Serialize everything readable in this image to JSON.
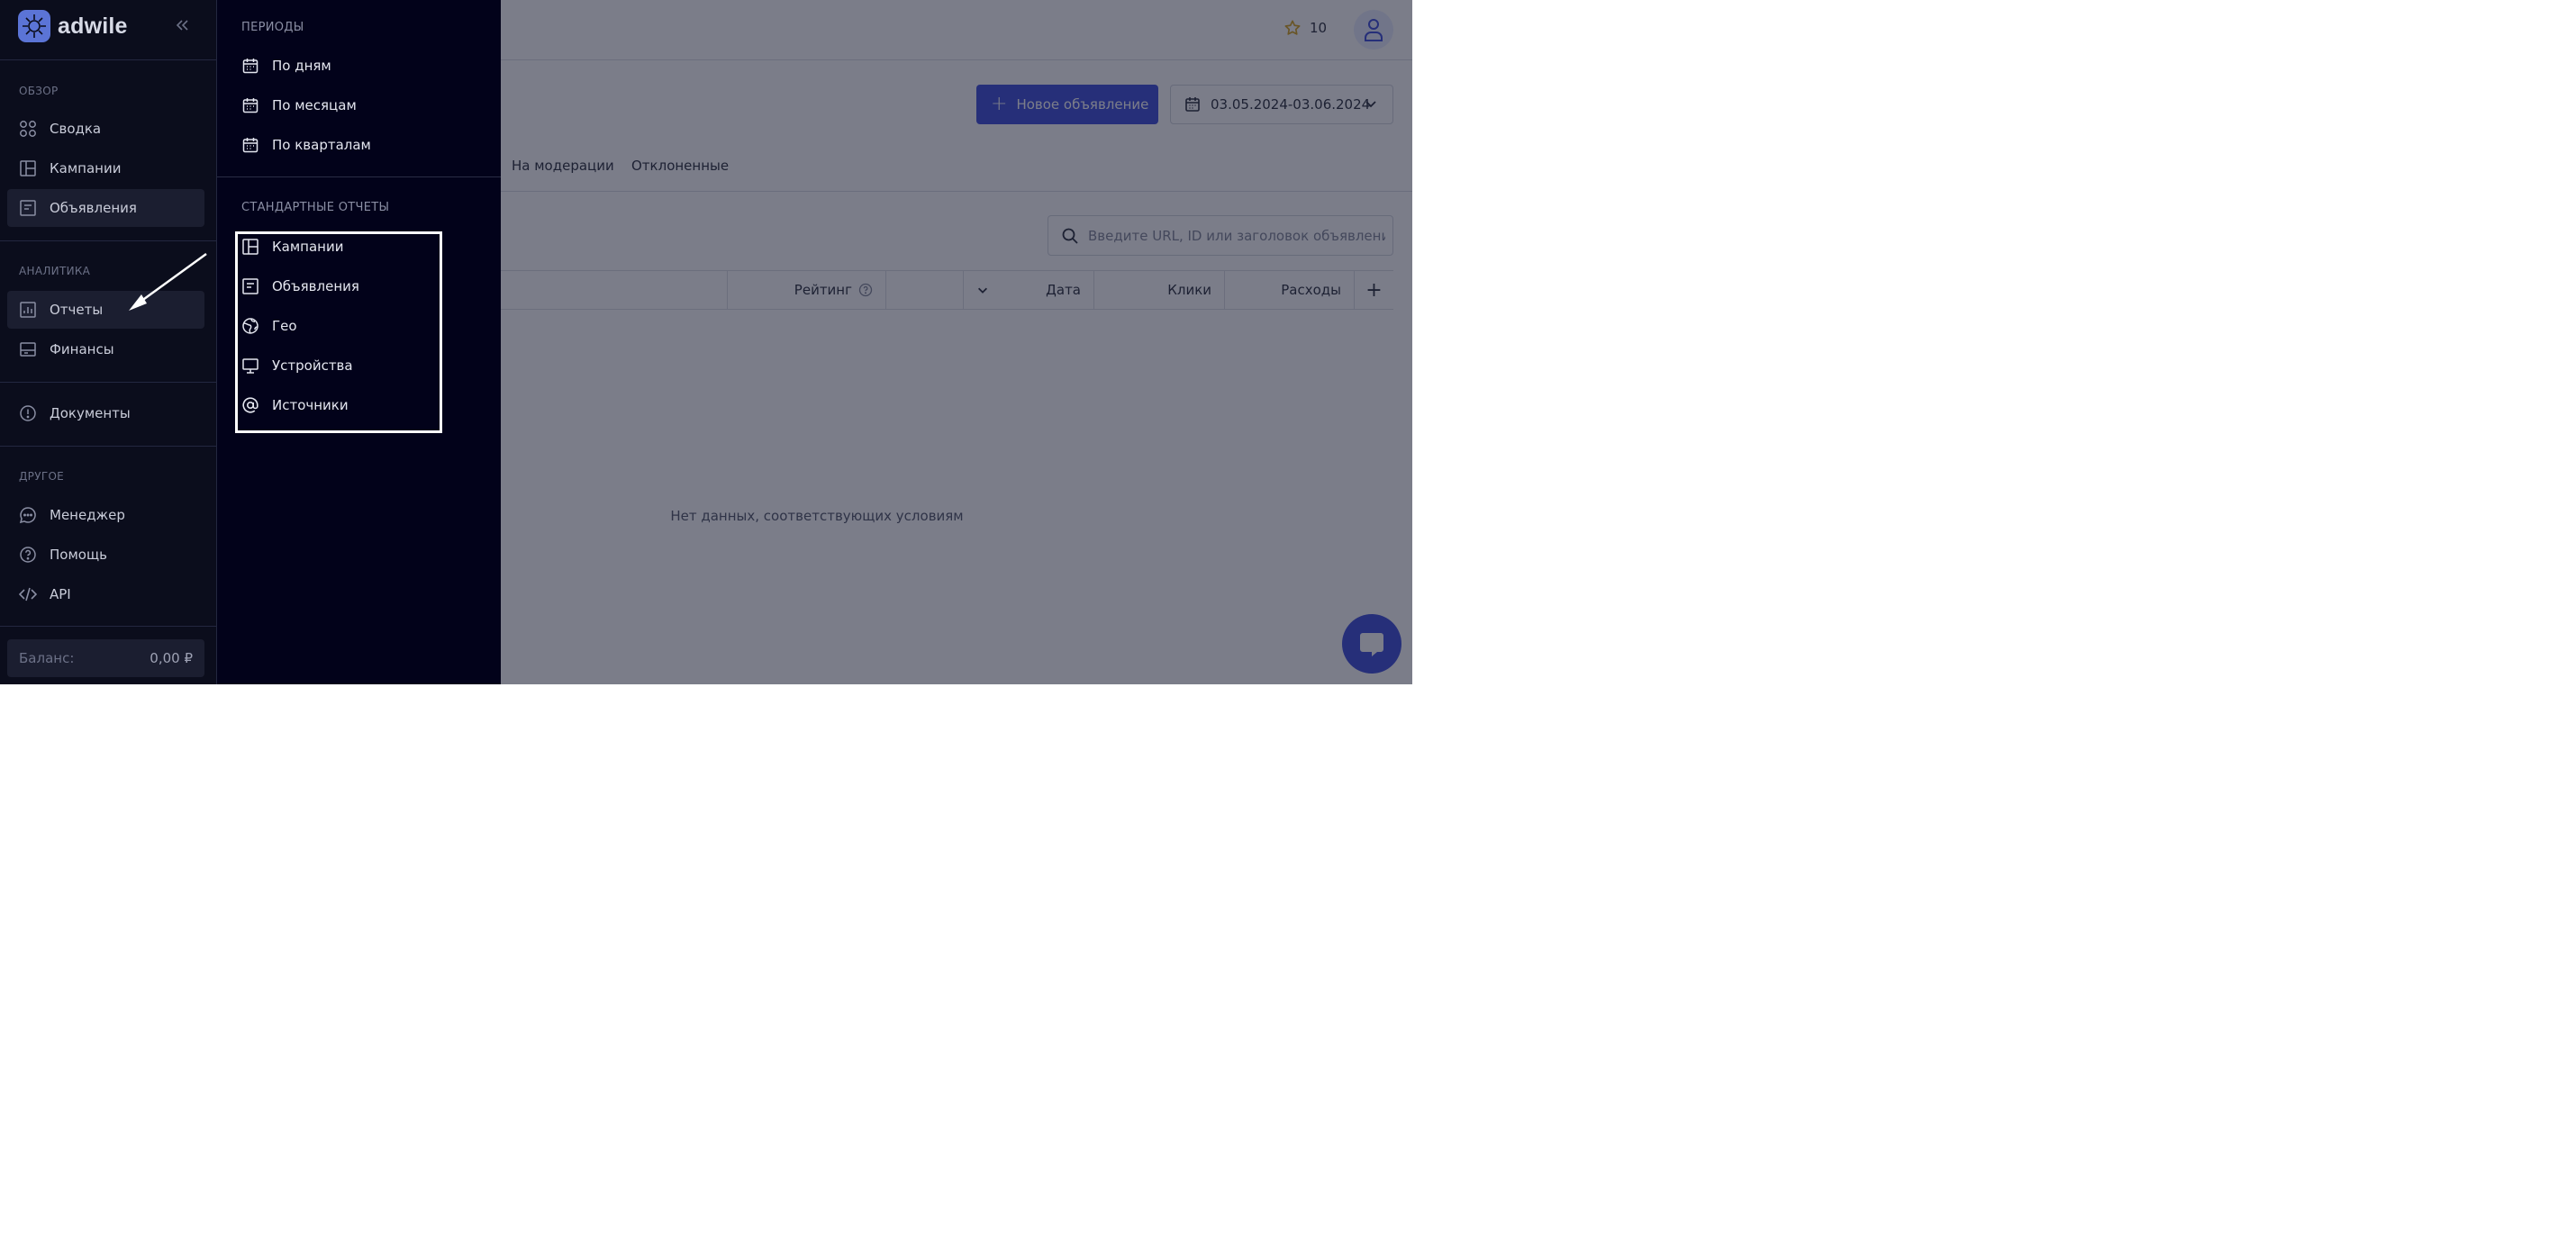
{
  "app": {
    "logo_text": "adwile"
  },
  "header": {
    "rating_count": "10"
  },
  "actions": {
    "new_ad_label": "Новое объявление",
    "date_range": "03.05.2024-03.06.2024"
  },
  "tabs": [
    "На модерации",
    "Отклоненные"
  ],
  "search": {
    "placeholder": "Введите URL, ID или заголовок объявления"
  },
  "table": {
    "columns": [
      "Рейтинг",
      "Дата",
      "Клики",
      "Расходы"
    ],
    "empty_message": "Нет данных, соответствующих условиям"
  },
  "sidebar": {
    "sections": {
      "overview": "ОБЗОР",
      "analytics": "АНАЛИТИКА",
      "other": "ДРУГОЕ"
    },
    "items": {
      "summary": "Сводка",
      "campaigns": "Кампании",
      "ads": "Объявления",
      "reports": "Отчеты",
      "finance": "Финансы",
      "documents": "Документы",
      "manager": "Менеджер",
      "help": "Помощь",
      "api": "API"
    },
    "balance": {
      "label": "Баланс:",
      "value": "0,00 ₽"
    }
  },
  "reports_menu": {
    "periods_title": "ПЕРИОДЫ",
    "periods": [
      "По дням",
      "По месяцам",
      "По кварталам"
    ],
    "standard_title": "СТАНДАРТНЫЕ ОТЧЕТЫ",
    "standard": [
      "Кампании",
      "Объявления",
      "Гео",
      "Устройства",
      "Источники"
    ]
  },
  "colors": {
    "accent": "#3647d9",
    "sidebar_bg": "#0b0d1c",
    "flyout_bg": "#02021a",
    "star": "#d4a017"
  }
}
